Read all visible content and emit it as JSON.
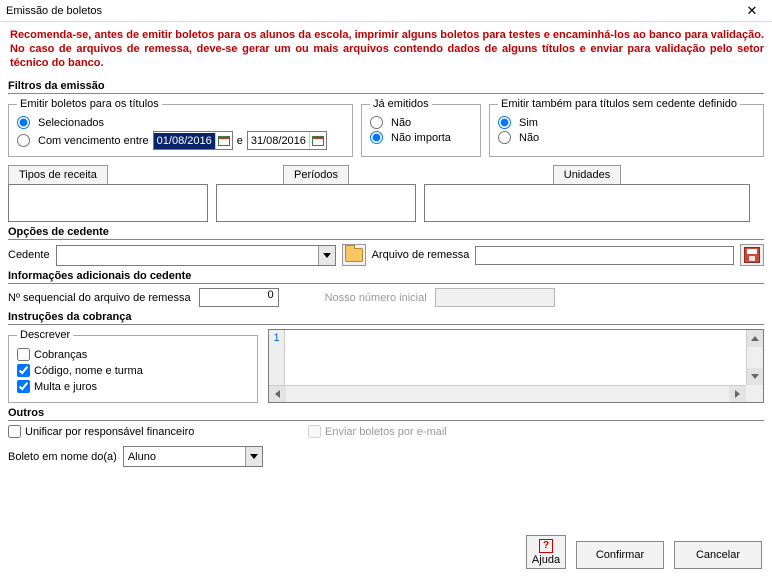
{
  "window": {
    "title": "Emissão de boletos"
  },
  "warning_text": "Recomenda-se, antes de emitir boletos para os alunos da escola, imprimir alguns boletos para testes e encaminhá-los ao banco para validação. No caso de arquivos de remessa, deve-se gerar um ou mais arquivos contendo dados de alguns títulos e enviar para validação pelo setor técnico do banco.",
  "filters": {
    "header": "Filtros da emissão",
    "titles": {
      "legend": "Emitir boletos para os títulos",
      "opt_selected": "Selecionados",
      "opt_due": "Com vencimento entre",
      "date_from": "01/08/2016",
      "date_sep": "e",
      "date_to": "31/08/2016"
    },
    "already": {
      "legend": "Já emitidos",
      "opt_no": "Não",
      "opt_ni": "Não importa"
    },
    "sem_cedente": {
      "legend": "Emitir também para títulos sem cedente definido",
      "opt_yes": "Sim",
      "opt_no": "Não"
    },
    "tab_receita": "Tipos de receita",
    "tab_periodos": "Períodos",
    "tab_unidades": "Unidades"
  },
  "cedente": {
    "header": "Opções de cedente",
    "cedente_label": "Cedente",
    "cedente_value": "",
    "arquivo_label": "Arquivo de remessa",
    "arquivo_value": ""
  },
  "info": {
    "header": "Informações adicionais do cedente",
    "seq_label": "Nº sequencial do arquivo de remessa",
    "seq_value": "0",
    "nossonum_label": "Nosso número inicial",
    "nossonum_value": ""
  },
  "instrucoes": {
    "header": "Instruções da cobrança",
    "legend": "Descrever",
    "chk_cobrancas": "Cobranças",
    "chk_codigo": "Código, nome e turma",
    "chk_multa": "Multa e juros",
    "memo_line": "1"
  },
  "outros": {
    "header": "Outros",
    "chk_unificar": "Unificar por responsável financeiro",
    "chk_enviar": "Enviar boletos por e-mail",
    "boleto_label": "Boleto em nome do(a)",
    "boleto_value": "Aluno"
  },
  "buttons": {
    "help": "Ajuda",
    "confirm": "Confirmar",
    "cancel": "Cancelar"
  }
}
